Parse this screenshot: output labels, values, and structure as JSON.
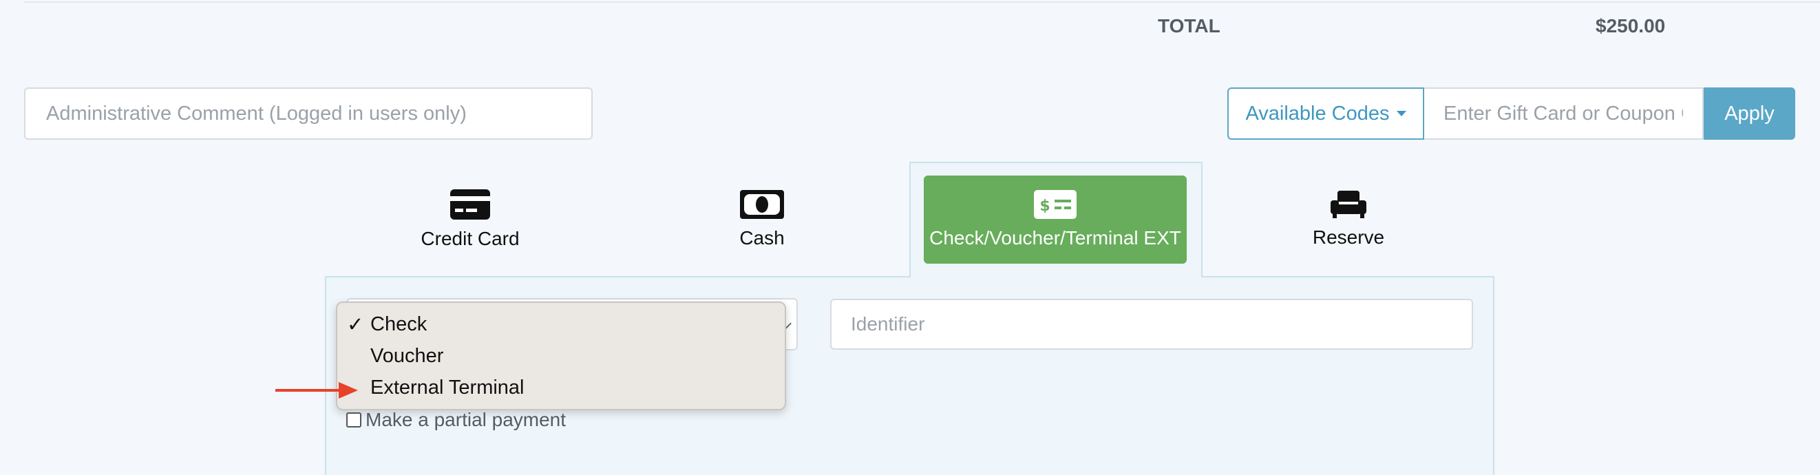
{
  "summary": {
    "total_label": "TOTAL",
    "total_value": "$250.00"
  },
  "admin_comment": {
    "placeholder": "Administrative Comment (Logged in users only)"
  },
  "coupon": {
    "codes_label": "Available Codes",
    "input_placeholder": "Enter Gift Card or Coupon Code",
    "apply_label": "Apply"
  },
  "payment_tabs": [
    {
      "label": "Credit Card",
      "icon": "credit-card-icon"
    },
    {
      "label": "Cash",
      "icon": "money-bill-icon"
    },
    {
      "label": "Check/Voucher/Terminal EXT",
      "icon": "money-check-icon",
      "active": true
    },
    {
      "label": "Reserve",
      "icon": "couch-icon"
    }
  ],
  "method_select": {
    "options": [
      "Check",
      "Voucher",
      "External Terminal"
    ],
    "selected": "Check",
    "check_mark": "✓"
  },
  "identifier": {
    "placeholder": "Identifier"
  },
  "partial_payment": {
    "label": "Make a partial payment",
    "checked": false
  },
  "colors": {
    "accent": "#5aa7c8",
    "active_tab": "#67ad5b",
    "arrow": "#e8412b"
  }
}
